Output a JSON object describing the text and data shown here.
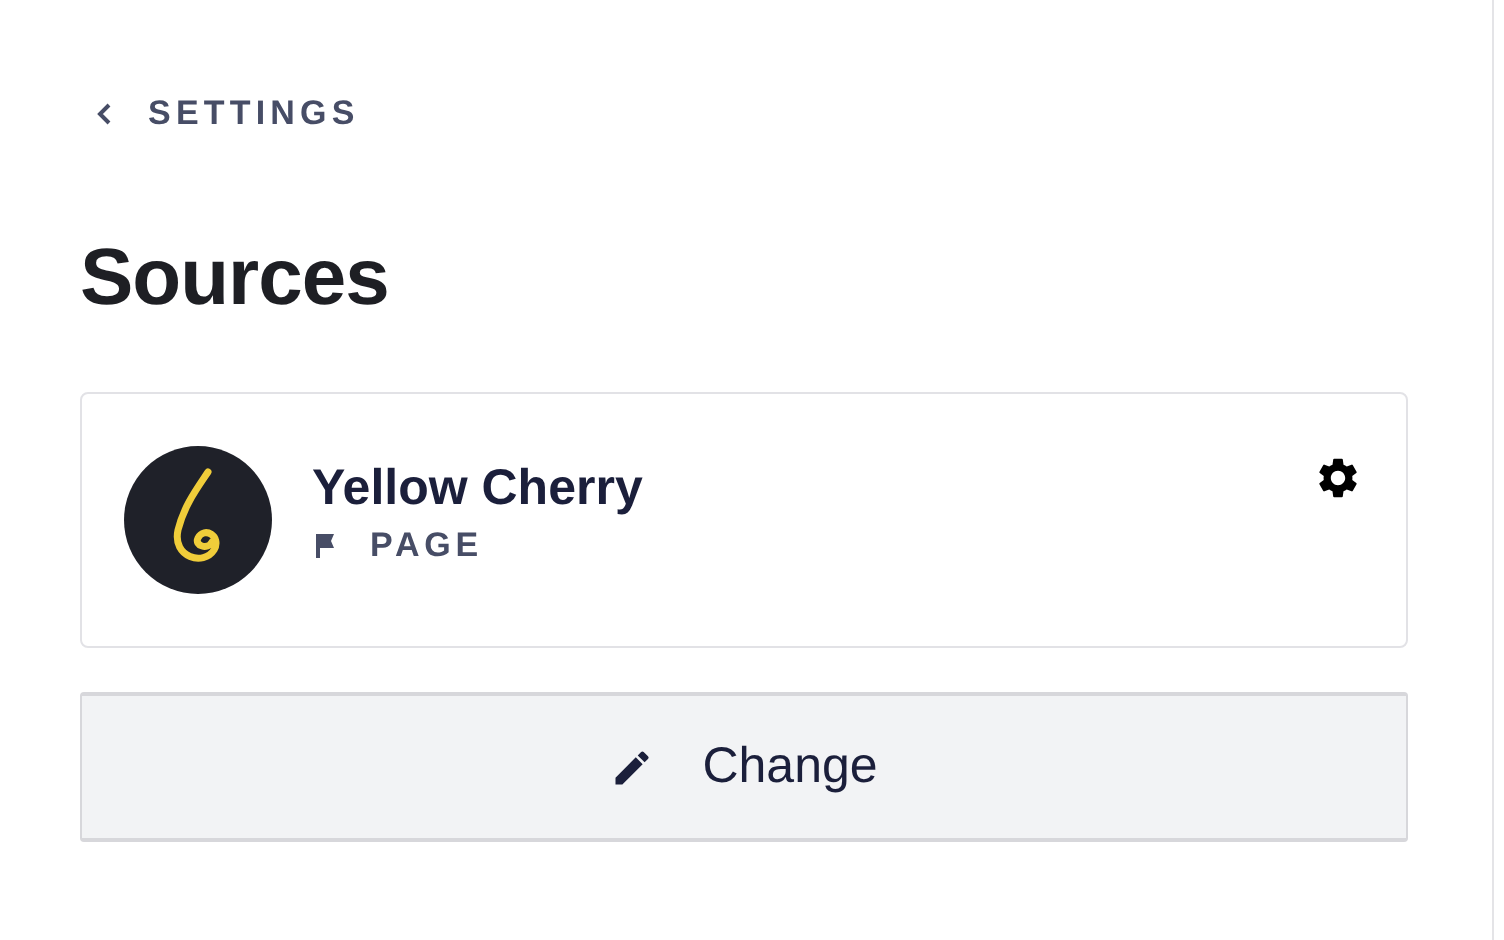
{
  "back_link": {
    "label": "SETTINGS"
  },
  "heading": "Sources",
  "source": {
    "name": "Yellow Cherry",
    "type": "PAGE"
  },
  "change_button": {
    "label": "Change"
  }
}
